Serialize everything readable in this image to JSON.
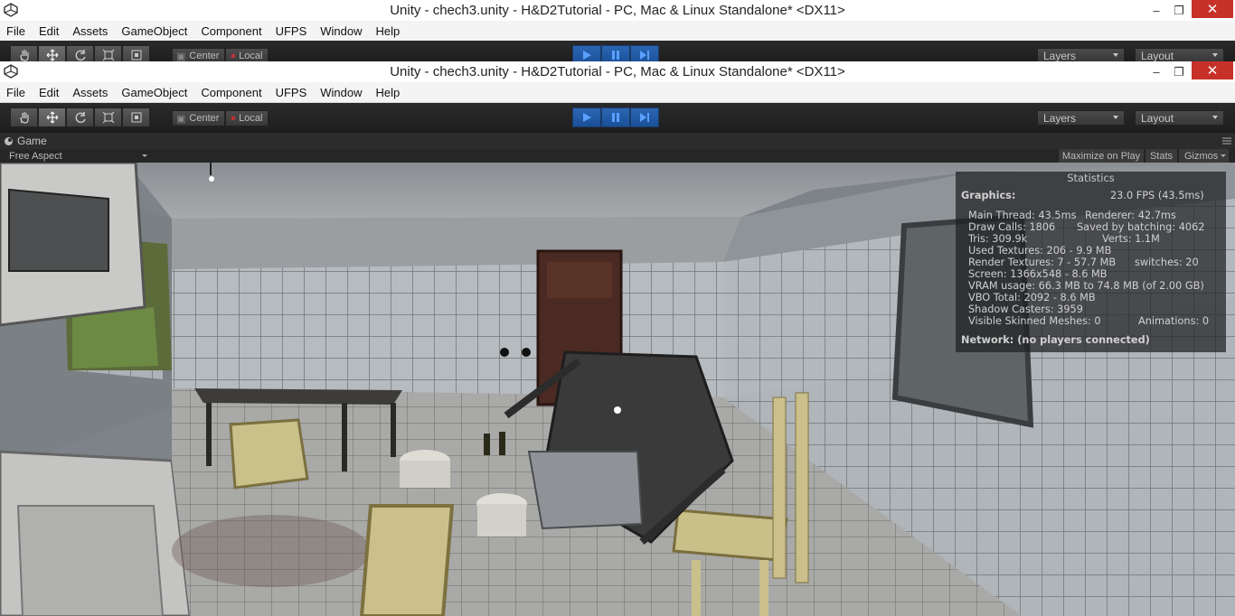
{
  "app": {
    "title": "Unity - chech3.unity - H&D2Tutorial - PC, Mac & Linux Standalone* <DX11>",
    "window_controls": {
      "minimize": "–",
      "maximize": "❐",
      "close": "✕"
    }
  },
  "menu": [
    "File",
    "Edit",
    "Assets",
    "GameObject",
    "Component",
    "UFPS",
    "Window",
    "Help"
  ],
  "toolbar": {
    "tools": [
      "hand-icon",
      "move-icon",
      "rotate-icon",
      "scale-icon",
      "rect-icon"
    ],
    "pivot_center": "Center",
    "pivot_local": "Local",
    "play_controls": [
      "play-icon",
      "pause-icon",
      "step-icon"
    ],
    "layers_label": "Layers",
    "layout_label": "Layout"
  },
  "game_view": {
    "tab_label": "Game",
    "aspect": "Free Aspect",
    "maximize_on_play": "Maximize on Play",
    "stats_button": "Stats",
    "gizmos_button": "Gizmos"
  },
  "statistics": {
    "header": "Statistics",
    "graphics_label": "Graphics:",
    "fps": "23.0 FPS (43.5ms)",
    "main_thread": "Main Thread: 43.5ms",
    "renderer": "Renderer: 42.7ms",
    "draw_calls": "Draw Calls: 1806",
    "saved_by_batching": "Saved by batching: 4062",
    "tris": "Tris: 309.9k",
    "verts": "Verts: 1.1M",
    "used_textures": "Used Textures: 206 - 9.9 MB",
    "render_textures": "Render Textures: 7 - 57.7 MB",
    "switches": "switches: 20",
    "screen": "Screen: 1366x548 - 8.6 MB",
    "vram": "VRAM usage: 66.3 MB to 74.8 MB (of 2.00 GB)",
    "vbo": "VBO Total: 2092 - 8.6 MB",
    "shadow_casters": "Shadow Casters: 3959",
    "skinned_meshes": "Visible Skinned Meshes: 0",
    "animations": "Animations: 0",
    "network": "Network: (no players connected)"
  },
  "colors": {
    "accent_play": "#2b66b3",
    "close_red": "#c7312a"
  }
}
